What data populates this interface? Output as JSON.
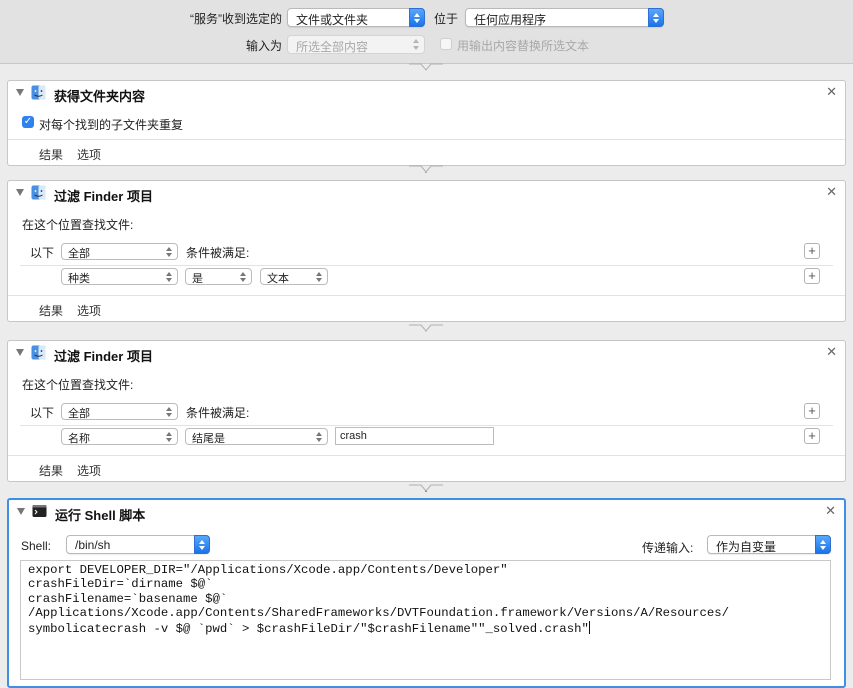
{
  "header": {
    "service_receives_label": "“服务”收到选定的",
    "input_type": "文件或文件夹",
    "in_label": "位于",
    "application": "任何应用程序",
    "input_is_label": "输入为",
    "input_is_value": "所选全部内容",
    "replace_label": "用输出内容替换所选文本"
  },
  "actions": [
    {
      "title": "获得文件夹内容",
      "checkbox_label": "对每个找到的子文件夹重复",
      "checked": true,
      "footer": [
        "结果",
        "选项"
      ]
    },
    {
      "title": "过滤 Finder 项目",
      "find_label": "在这个位置查找文件:",
      "all_prefix": "以下",
      "all_value": "全部",
      "conditions_label": "条件被满足:",
      "rule": {
        "attribute": "种类",
        "operator": "是",
        "value": "文本"
      },
      "footer": [
        "结果",
        "选项"
      ]
    },
    {
      "title": "过滤 Finder 项目",
      "find_label": "在这个位置查找文件:",
      "all_prefix": "以下",
      "all_value": "全部",
      "conditions_label": "条件被满足:",
      "rule": {
        "attribute": "名称",
        "operator": "结尾是",
        "value": "crash"
      },
      "footer": [
        "结果",
        "选项"
      ]
    },
    {
      "title": "运行 Shell 脚本",
      "shell_label": "Shell:",
      "shell_value": "/bin/sh",
      "pass_input_label": "传递输入:",
      "pass_input_value": "作为自变量",
      "script": "export DEVELOPER_DIR=\"/Applications/Xcode.app/Contents/Developer\"\ncrashFileDir=`dirname $@`\ncrashFilename=`basename $@`\n/Applications/Xcode.app/Contents/SharedFrameworks/DVTFoundation.framework/Versions/A/Resources/\nsymbolicatecrash -v $@ `pwd` > $crashFileDir/\"$crashFilename\"\"_solved.crash\""
    }
  ],
  "icons": {
    "finder": "finder-icon",
    "terminal": "terminal-icon",
    "close": "close-icon",
    "disclosure": "disclosure-triangle-icon",
    "plus": "plus-icon"
  }
}
